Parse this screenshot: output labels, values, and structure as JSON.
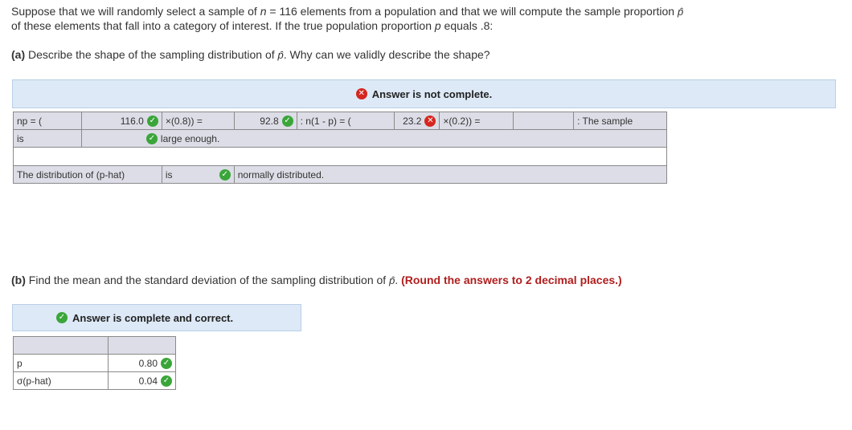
{
  "question": {
    "line1_prefix": "Suppose that we will randomly select a sample of ",
    "n_symbol": "n",
    "line1_eq": " = 116 elements from a population and that we will compute the sample proportion ",
    "phat_symbol": "p̂",
    "line2_prefix": " of these elements that fall into a category of interest. If the true population proportion ",
    "p_symbol": "p",
    "line2_suffix": " equals .8:"
  },
  "part_a": {
    "label": "(a)",
    "text": " Describe the shape of the sampling distribution of ",
    "text_after": ". Why can we validly describe the shape?",
    "banner_text": "Answer is not complete.",
    "rows": {
      "r1": {
        "np_label": "np = (",
        "np_value": "116.0",
        "times_08": "×(0.8)) =",
        "result1": "92.8",
        "n1p_label": ": n(1 - p) = (",
        "n1p_value": "23.2",
        "times_02": "×(0.2)) =",
        "trail": ": The sample"
      },
      "r2": {
        "is": "is",
        "large": "large enough."
      },
      "r4": {
        "dist": "The distribution of (p-hat)",
        "is": "is",
        "normal": "normally distributed."
      }
    }
  },
  "part_b": {
    "label": "(b)",
    "text": " Find the mean and the standard deviation of the sampling distribution of ",
    "text_after": ". ",
    "round_note": "(Round the answers to 2 decimal places.)",
    "banner_text": "Answer is complete and correct.",
    "rows": [
      {
        "label": "p",
        "value": "0.80"
      },
      {
        "label": "σ(p-hat)",
        "value": "0.04"
      }
    ]
  },
  "icons": {
    "correct": "check-circle-icon",
    "incorrect": "x-circle-icon"
  },
  "colors": {
    "banner_bg": "#dde9f6",
    "correct": "#3aa63a",
    "incorrect": "#d6261f",
    "round_note": "#b01e1e"
  }
}
